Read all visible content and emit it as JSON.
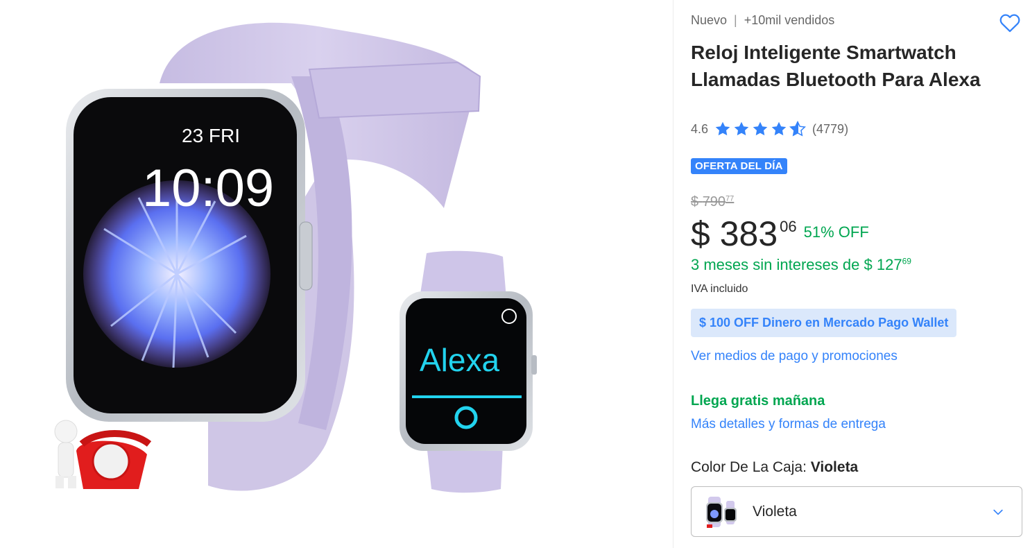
{
  "product": {
    "condition": "Nuevo",
    "separator": "|",
    "sold": "+10mil vendidos",
    "title": "Reloj Inteligente Smartwatch Llamadas Bluetooth Para Alexa",
    "rating": {
      "average": "4.6",
      "count": "(4779)",
      "stars": 4.6
    },
    "badge": "OFERTA DEL DÍA",
    "old_price": {
      "symbol": "$",
      "amount": "790",
      "cents": "77"
    },
    "price": {
      "symbol": "$",
      "amount": "383",
      "cents": "06"
    },
    "discount": "51% OFF",
    "installments": {
      "text": "3 meses sin intereses de",
      "symbol": "$",
      "amount": "127",
      "cents": "69"
    },
    "tax_note": "IVA incluido",
    "wallet_promo": "$ 100 OFF Dinero en Mercado Pago Wallet",
    "payments_link": "Ver medios de pago y promociones",
    "delivery": "Llega gratis mañana",
    "shipping_link": "Más detalles y formas de entrega",
    "variant": {
      "label": "Color De La Caja:",
      "selected": "Violeta",
      "dropdown_value": "Violeta"
    }
  },
  "image": {
    "watch_screen_date": "23 FRI",
    "watch_screen_time": "10:09",
    "small_watch_text": "Alexa"
  },
  "icons": {
    "favorite": "heart-icon",
    "star": "star-icon",
    "dropdown": "chevron-down-icon"
  },
  "colors": {
    "accent_blue": "#3483fa",
    "green": "#00a650",
    "badge_bg": "#3483fa",
    "wallet_bg": "#dbe8fb",
    "strap": "#cfc6e6"
  }
}
